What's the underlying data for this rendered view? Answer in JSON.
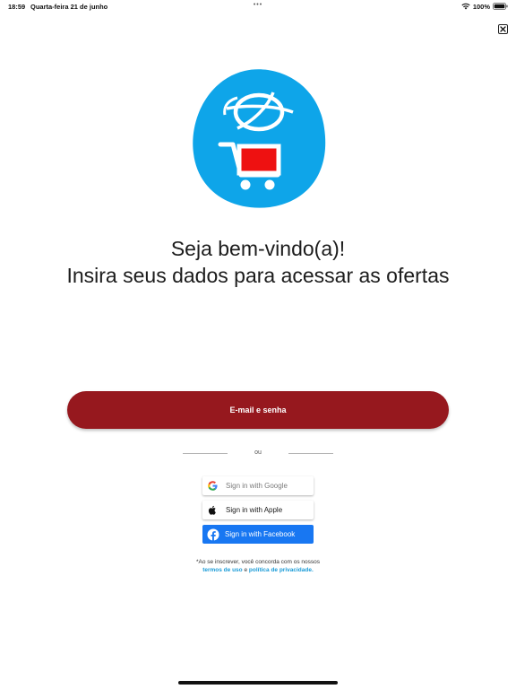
{
  "status_bar": {
    "time": "18:59",
    "date": "Quarta-feira 21 de junho",
    "dots": "•••",
    "battery": "100%",
    "icons": [
      "wifi-icon",
      "battery-icon"
    ]
  },
  "colors": {
    "primary_button": "#96181e",
    "facebook": "#1877f2",
    "link": "#1a9bd7",
    "logo_blue": "#0ea5e9",
    "logo_red": "#ee1111"
  },
  "welcome": {
    "title": "Seja bem-vindo(a)!",
    "subtitle": "Insira seus dados para acessar as ofertas"
  },
  "email_button": {
    "label": "E-mail e senha"
  },
  "divider": {
    "text": "ou"
  },
  "social": {
    "google": {
      "label": "Sign in with Google",
      "icon": "google-icon"
    },
    "apple": {
      "label": "Sign in with Apple",
      "icon": "apple-icon"
    },
    "facebook": {
      "label": "Sign in with Facebook",
      "icon": "facebook-icon"
    }
  },
  "terms": {
    "line1": "*Ao se inscrever, você concorda com os nossos",
    "terms_link": "termos de uso",
    "conjunction": "e",
    "privacy_link": "política de privacidade",
    "period": "."
  },
  "close_icon": "close-icon",
  "logo_icon": "shopping-cart-globe-logo"
}
